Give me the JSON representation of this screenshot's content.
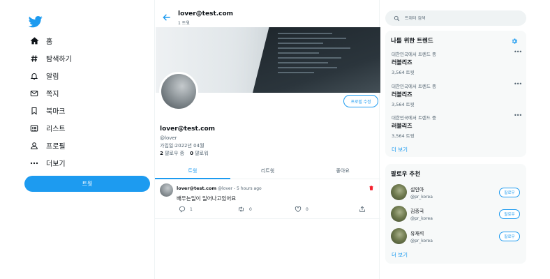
{
  "nav": {
    "items": [
      {
        "label": "홈",
        "icon": "home-icon"
      },
      {
        "label": "탐색하기",
        "icon": "hashtag-icon"
      },
      {
        "label": "알림",
        "icon": "bell-icon"
      },
      {
        "label": "쪽지",
        "icon": "mail-icon"
      },
      {
        "label": "북마크",
        "icon": "bookmark-icon"
      },
      {
        "label": "리스트",
        "icon": "list-icon"
      },
      {
        "label": "프로필",
        "icon": "person-icon"
      },
      {
        "label": "더보기",
        "icon": "more-icon"
      }
    ],
    "tweet_button": "트윗"
  },
  "header": {
    "name": "lover@test.com",
    "tweet_count": "1 트윗"
  },
  "profile": {
    "edit_button": "프로필 수정",
    "name": "lover@test.com",
    "handle": "@lover",
    "joined": "가입일:2022년 04월",
    "following_count": "2",
    "following_label": "팔로우 중",
    "followers_count": "0",
    "followers_label": "팔로워"
  },
  "tabs": [
    "트윗",
    "리트윗",
    "좋아요"
  ],
  "tweet": {
    "name": "lover@test.com",
    "meta": "@lover - 5 hours ago",
    "text": "배우는일이 일어나고있어요",
    "replies": "1",
    "retweets": "0",
    "likes": "0"
  },
  "search": {
    "placeholder": "트위터 검색"
  },
  "trends": {
    "title": "나를 위한 트렌드",
    "items": [
      {
        "context": "대한민국에서 트렌드 중",
        "name": "러블리즈",
        "count": "3,564 트윗"
      },
      {
        "context": "대한민국에서 트렌드 중",
        "name": "러블리즈",
        "count": "3,564 트윗"
      },
      {
        "context": "대한민국에서 트렌드 중",
        "name": "러블리즈",
        "count": "3,564 트윗"
      }
    ],
    "more_glyph": "•••",
    "show_more": "더 보기"
  },
  "who_to_follow": {
    "title": "팔로우 추천",
    "users": [
      {
        "name": "설인아",
        "handle": "@pr_korea",
        "button": "팔로우"
      },
      {
        "name": "김종국",
        "handle": "@pr_korea",
        "button": "팔로우"
      },
      {
        "name": "유재석",
        "handle": "@pr_korea",
        "button": "팔로우"
      }
    ],
    "show_more": "더 보기"
  },
  "colors": {
    "accent": "#1d9bf0",
    "delete": "#f4212e"
  }
}
